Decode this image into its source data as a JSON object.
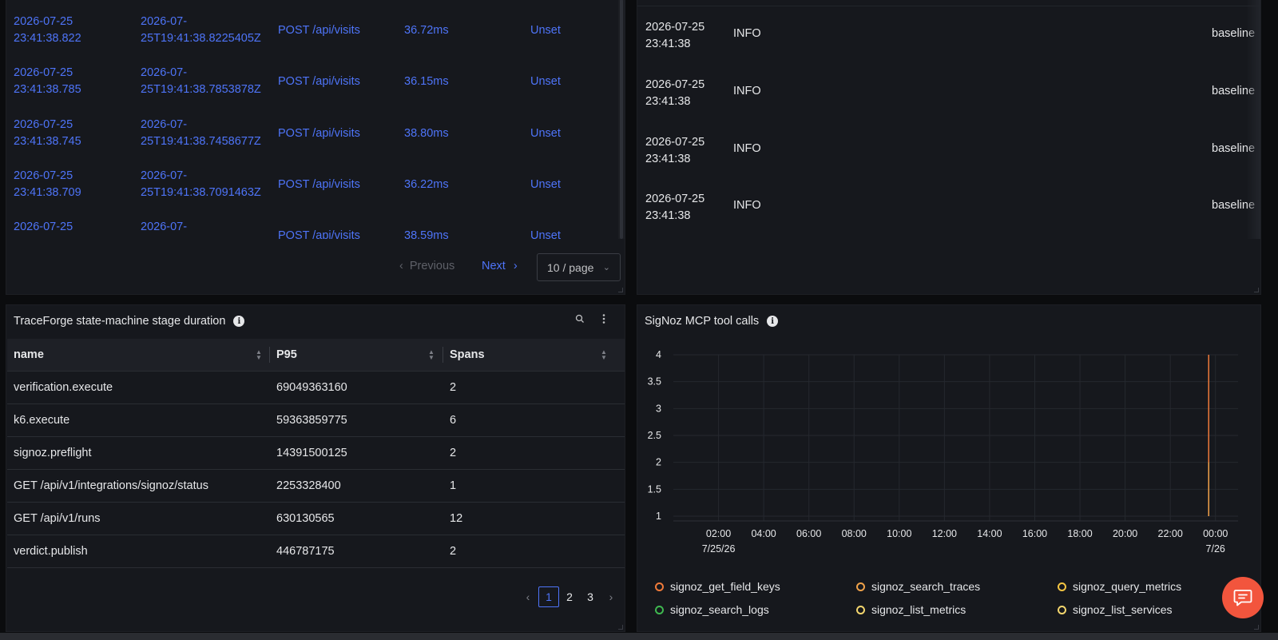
{
  "traces": {
    "rows": [
      {
        "timestamp": [
          "2026-07-25",
          "23:41:38.822"
        ],
        "start": [
          "2026-07-",
          "25T19:41:38.8225405Z"
        ],
        "operation": "POST /api/visits",
        "duration": "36.72ms",
        "status": "Unset"
      },
      {
        "timestamp": [
          "2026-07-25",
          "23:41:38.785"
        ],
        "start": [
          "2026-07-",
          "25T19:41:38.7853878Z"
        ],
        "operation": "POST /api/visits",
        "duration": "36.15ms",
        "status": "Unset"
      },
      {
        "timestamp": [
          "2026-07-25",
          "23:41:38.745"
        ],
        "start": [
          "2026-07-",
          "25T19:41:38.7458677Z"
        ],
        "operation": "POST /api/visits",
        "duration": "38.80ms",
        "status": "Unset"
      },
      {
        "timestamp": [
          "2026-07-25",
          "23:41:38.709"
        ],
        "start": [
          "2026-07-",
          "25T19:41:38.7091463Z"
        ],
        "operation": "POST /api/visits",
        "duration": "36.22ms",
        "status": "Unset"
      },
      {
        "timestamp": [
          "2026-07-25",
          ""
        ],
        "start": [
          "2026-07-",
          ""
        ],
        "operation": "POST /api/visits",
        "duration": "38.59ms",
        "status": "Unset"
      }
    ],
    "pagination": {
      "previous": "Previous",
      "next": "Next",
      "page_size": "10 / page"
    }
  },
  "logs": {
    "rows": [
      {
        "timestamp": [
          "2026-07-25",
          "23:41:38"
        ],
        "level": "INFO",
        "body": "baseline"
      },
      {
        "timestamp": [
          "2026-07-25",
          "23:41:38"
        ],
        "level": "INFO",
        "body": "baseline"
      },
      {
        "timestamp": [
          "2026-07-25",
          "23:41:38"
        ],
        "level": "INFO",
        "body": "baseline"
      },
      {
        "timestamp": [
          "2026-07-25",
          "23:41:38"
        ],
        "level": "INFO",
        "body": "baseline"
      }
    ]
  },
  "stage_panel": {
    "title": "TraceForge state-machine stage duration",
    "columns": [
      "name",
      "P95",
      "Spans"
    ],
    "rows": [
      {
        "name": "verification.execute",
        "p95": "69049363160",
        "spans": "2"
      },
      {
        "name": "k6.execute",
        "p95": "59363859775",
        "spans": "6"
      },
      {
        "name": "signoz.preflight",
        "p95": "14391500125",
        "spans": "2"
      },
      {
        "name": "GET /api/v1/integrations/signoz/status",
        "p95": "2253328400",
        "spans": "1"
      },
      {
        "name": "GET /api/v1/runs",
        "p95": "630130565",
        "spans": "12"
      },
      {
        "name": "verdict.publish",
        "p95": "446787175",
        "spans": "2"
      }
    ],
    "pages": [
      "1",
      "2",
      "3"
    ],
    "active_page": "1"
  },
  "chart_panel": {
    "title": "SigNoz MCP tool calls",
    "legend": [
      {
        "name": "signoz_get_field_keys",
        "color": "#f07a3a"
      },
      {
        "name": "signoz_search_traces",
        "color": "#f0a24a"
      },
      {
        "name": "signoz_query_metrics",
        "color": "#f5c542"
      },
      {
        "name": "signoz_search_logs",
        "color": "#3fb950"
      },
      {
        "name": "signoz_list_metrics",
        "color": "#f5d76e"
      },
      {
        "name": "signoz_list_services",
        "color": "#f5d76e"
      }
    ]
  },
  "chart_data": {
    "type": "line",
    "title": "SigNoz MCP tool calls",
    "xlabel": "",
    "ylabel": "",
    "ylim": [
      1,
      4
    ],
    "y_ticks": [
      "1",
      "1.5",
      "2",
      "2.5",
      "3",
      "3.5",
      "4"
    ],
    "x_ticks": [
      {
        "label": "02:00",
        "sub": "7/25/26"
      },
      {
        "label": "04:00",
        "sub": ""
      },
      {
        "label": "06:00",
        "sub": ""
      },
      {
        "label": "08:00",
        "sub": ""
      },
      {
        "label": "10:00",
        "sub": ""
      },
      {
        "label": "12:00",
        "sub": ""
      },
      {
        "label": "14:00",
        "sub": ""
      },
      {
        "label": "16:00",
        "sub": ""
      },
      {
        "label": "18:00",
        "sub": ""
      },
      {
        "label": "20:00",
        "sub": ""
      },
      {
        "label": "22:00",
        "sub": ""
      },
      {
        "label": "00:00",
        "sub": "7/26"
      }
    ],
    "x_range_hours": [
      0,
      25
    ],
    "series": [
      {
        "name": "signoz_get_field_keys",
        "color": "#f07a3a",
        "x": [
          23.7,
          23.7
        ],
        "y": [
          1,
          4
        ]
      },
      {
        "name": "signoz_search_traces",
        "color": "#f0a24a",
        "x": [
          23.7,
          23.7
        ],
        "y": [
          1,
          2
        ]
      }
    ],
    "grid": true,
    "legend_position": "bottom"
  },
  "colors": {
    "link": "#4e74f8",
    "accent": "#f2553d"
  }
}
